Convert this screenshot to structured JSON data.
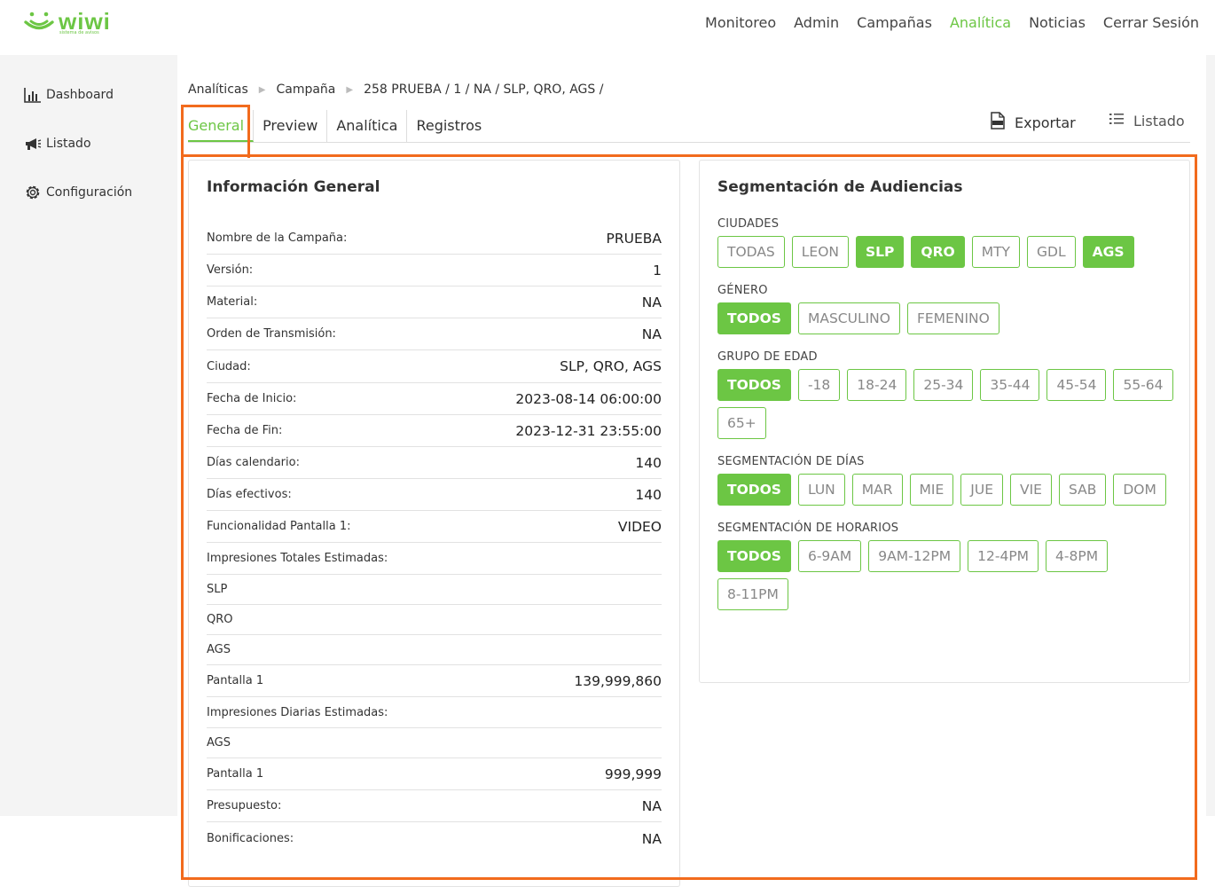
{
  "app": {
    "logo_text": "wiwi",
    "logo_sub": "sistema de avisos"
  },
  "nav": {
    "items": [
      "Monitoreo",
      "Admin",
      "Campañas",
      "Analítica",
      "Noticias",
      "Cerrar Sesión"
    ],
    "active": "Analítica"
  },
  "sidebar": {
    "items": [
      {
        "label": "Dashboard",
        "icon": "bar-chart-icon"
      },
      {
        "label": "Listado",
        "icon": "megaphone-icon"
      },
      {
        "label": "Configuración",
        "icon": "gear-icon"
      }
    ]
  },
  "breadcrumb": [
    "Analíticas",
    "Campaña",
    "258 PRUEBA / 1 / NA / SLP, QRO, AGS /"
  ],
  "tabs": [
    "General",
    "Preview",
    "Analítica",
    "Registros"
  ],
  "active_tab": "General",
  "toolbar": {
    "export_label": "Exportar",
    "list_label": "Listado"
  },
  "info": {
    "title": "Información General",
    "rows": [
      {
        "label": "Nombre de la Campaña:",
        "value": "PRUEBA"
      },
      {
        "label": "Versión:",
        "value": "1"
      },
      {
        "label": "Material:",
        "value": "NA"
      },
      {
        "label": "Orden de Transmisión:",
        "value": "NA"
      },
      {
        "label": "Ciudad:",
        "value": "SLP, QRO, AGS"
      },
      {
        "label": "Fecha de Inicio:",
        "value": "2023-08-14 06:00:00"
      },
      {
        "label": "Fecha de Fin:",
        "value": "2023-12-31 23:55:00"
      },
      {
        "label": "Días calendario:",
        "value": "140"
      },
      {
        "label": "Días efectivos:",
        "value": "140"
      },
      {
        "label": "Funcionalidad Pantalla 1:",
        "value": "VIDEO"
      },
      {
        "label": "Impresiones Totales Estimadas:",
        "value": ""
      },
      {
        "label": "SLP",
        "value": ""
      },
      {
        "label": "QRO",
        "value": ""
      },
      {
        "label": "AGS",
        "value": ""
      },
      {
        "label": "Pantalla 1",
        "value": "139,999,860"
      },
      {
        "label": "Impresiones Diarias Estimadas:",
        "value": ""
      },
      {
        "label": "AGS",
        "value": ""
      },
      {
        "label": "Pantalla 1",
        "value": "999,999"
      },
      {
        "label": "Presupuesto:",
        "value": "NA"
      },
      {
        "label": "Bonificaciones:",
        "value": "NA"
      }
    ]
  },
  "segmentation": {
    "title": "Segmentación de Audiencias",
    "groups": [
      {
        "title": "CIUDADES",
        "chips": [
          {
            "label": "TODAS",
            "on": false
          },
          {
            "label": "LEON",
            "on": false
          },
          {
            "label": "SLP",
            "on": true
          },
          {
            "label": "QRO",
            "on": true
          },
          {
            "label": "MTY",
            "on": false
          },
          {
            "label": "GDL",
            "on": false
          },
          {
            "label": "AGS",
            "on": true
          }
        ]
      },
      {
        "title": "GÉNERO",
        "chips": [
          {
            "label": "TODOS",
            "on": true
          },
          {
            "label": "MASCULINO",
            "on": false
          },
          {
            "label": "FEMENINO",
            "on": false
          }
        ]
      },
      {
        "title": "GRUPO DE EDAD",
        "chips": [
          {
            "label": "TODOS",
            "on": true
          },
          {
            "label": "-18",
            "on": false
          },
          {
            "label": "18-24",
            "on": false
          },
          {
            "label": "25-34",
            "on": false
          },
          {
            "label": "35-44",
            "on": false
          },
          {
            "label": "45-54",
            "on": false
          },
          {
            "label": "55-64",
            "on": false
          },
          {
            "label": "65+",
            "on": false
          }
        ]
      },
      {
        "title": "SEGMENTACIÓN DE DÍAS",
        "chips": [
          {
            "label": "TODOS",
            "on": true
          },
          {
            "label": "LUN",
            "on": false
          },
          {
            "label": "MAR",
            "on": false
          },
          {
            "label": "MIE",
            "on": false
          },
          {
            "label": "JUE",
            "on": false
          },
          {
            "label": "VIE",
            "on": false
          },
          {
            "label": "SAB",
            "on": false
          },
          {
            "label": "DOM",
            "on": false
          }
        ]
      },
      {
        "title": "SEGMENTACIÓN DE HORARIOS",
        "chips": [
          {
            "label": "TODOS",
            "on": true
          },
          {
            "label": "6-9AM",
            "on": false
          },
          {
            "label": "9AM-12PM",
            "on": false
          },
          {
            "label": "12-4PM",
            "on": false
          },
          {
            "label": "4-8PM",
            "on": false
          },
          {
            "label": "8-11PM",
            "on": false
          }
        ]
      }
    ]
  },
  "colors": {
    "brand": "#6cc644",
    "highlight": "#f26b1d"
  }
}
